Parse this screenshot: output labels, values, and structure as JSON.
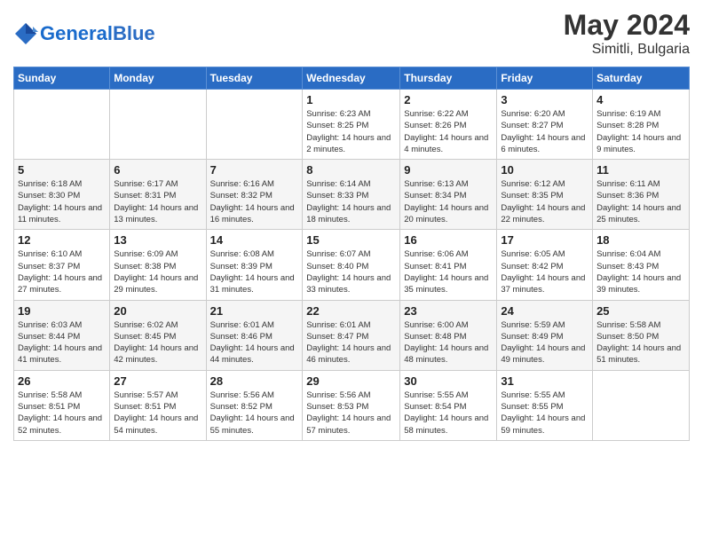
{
  "header": {
    "logo_general": "General",
    "logo_blue": "Blue",
    "month_year": "May 2024",
    "location": "Simitli, Bulgaria"
  },
  "weekdays": [
    "Sunday",
    "Monday",
    "Tuesday",
    "Wednesday",
    "Thursday",
    "Friday",
    "Saturday"
  ],
  "weeks": [
    [
      {
        "day": "",
        "sunrise": "",
        "sunset": "",
        "daylight": ""
      },
      {
        "day": "",
        "sunrise": "",
        "sunset": "",
        "daylight": ""
      },
      {
        "day": "",
        "sunrise": "",
        "sunset": "",
        "daylight": ""
      },
      {
        "day": "1",
        "sunrise": "Sunrise: 6:23 AM",
        "sunset": "Sunset: 8:25 PM",
        "daylight": "Daylight: 14 hours and 2 minutes."
      },
      {
        "day": "2",
        "sunrise": "Sunrise: 6:22 AM",
        "sunset": "Sunset: 8:26 PM",
        "daylight": "Daylight: 14 hours and 4 minutes."
      },
      {
        "day": "3",
        "sunrise": "Sunrise: 6:20 AM",
        "sunset": "Sunset: 8:27 PM",
        "daylight": "Daylight: 14 hours and 6 minutes."
      },
      {
        "day": "4",
        "sunrise": "Sunrise: 6:19 AM",
        "sunset": "Sunset: 8:28 PM",
        "daylight": "Daylight: 14 hours and 9 minutes."
      }
    ],
    [
      {
        "day": "5",
        "sunrise": "Sunrise: 6:18 AM",
        "sunset": "Sunset: 8:30 PM",
        "daylight": "Daylight: 14 hours and 11 minutes."
      },
      {
        "day": "6",
        "sunrise": "Sunrise: 6:17 AM",
        "sunset": "Sunset: 8:31 PM",
        "daylight": "Daylight: 14 hours and 13 minutes."
      },
      {
        "day": "7",
        "sunrise": "Sunrise: 6:16 AM",
        "sunset": "Sunset: 8:32 PM",
        "daylight": "Daylight: 14 hours and 16 minutes."
      },
      {
        "day": "8",
        "sunrise": "Sunrise: 6:14 AM",
        "sunset": "Sunset: 8:33 PM",
        "daylight": "Daylight: 14 hours and 18 minutes."
      },
      {
        "day": "9",
        "sunrise": "Sunrise: 6:13 AM",
        "sunset": "Sunset: 8:34 PM",
        "daylight": "Daylight: 14 hours and 20 minutes."
      },
      {
        "day": "10",
        "sunrise": "Sunrise: 6:12 AM",
        "sunset": "Sunset: 8:35 PM",
        "daylight": "Daylight: 14 hours and 22 minutes."
      },
      {
        "day": "11",
        "sunrise": "Sunrise: 6:11 AM",
        "sunset": "Sunset: 8:36 PM",
        "daylight": "Daylight: 14 hours and 25 minutes."
      }
    ],
    [
      {
        "day": "12",
        "sunrise": "Sunrise: 6:10 AM",
        "sunset": "Sunset: 8:37 PM",
        "daylight": "Daylight: 14 hours and 27 minutes."
      },
      {
        "day": "13",
        "sunrise": "Sunrise: 6:09 AM",
        "sunset": "Sunset: 8:38 PM",
        "daylight": "Daylight: 14 hours and 29 minutes."
      },
      {
        "day": "14",
        "sunrise": "Sunrise: 6:08 AM",
        "sunset": "Sunset: 8:39 PM",
        "daylight": "Daylight: 14 hours and 31 minutes."
      },
      {
        "day": "15",
        "sunrise": "Sunrise: 6:07 AM",
        "sunset": "Sunset: 8:40 PM",
        "daylight": "Daylight: 14 hours and 33 minutes."
      },
      {
        "day": "16",
        "sunrise": "Sunrise: 6:06 AM",
        "sunset": "Sunset: 8:41 PM",
        "daylight": "Daylight: 14 hours and 35 minutes."
      },
      {
        "day": "17",
        "sunrise": "Sunrise: 6:05 AM",
        "sunset": "Sunset: 8:42 PM",
        "daylight": "Daylight: 14 hours and 37 minutes."
      },
      {
        "day": "18",
        "sunrise": "Sunrise: 6:04 AM",
        "sunset": "Sunset: 8:43 PM",
        "daylight": "Daylight: 14 hours and 39 minutes."
      }
    ],
    [
      {
        "day": "19",
        "sunrise": "Sunrise: 6:03 AM",
        "sunset": "Sunset: 8:44 PM",
        "daylight": "Daylight: 14 hours and 41 minutes."
      },
      {
        "day": "20",
        "sunrise": "Sunrise: 6:02 AM",
        "sunset": "Sunset: 8:45 PM",
        "daylight": "Daylight: 14 hours and 42 minutes."
      },
      {
        "day": "21",
        "sunrise": "Sunrise: 6:01 AM",
        "sunset": "Sunset: 8:46 PM",
        "daylight": "Daylight: 14 hours and 44 minutes."
      },
      {
        "day": "22",
        "sunrise": "Sunrise: 6:01 AM",
        "sunset": "Sunset: 8:47 PM",
        "daylight": "Daylight: 14 hours and 46 minutes."
      },
      {
        "day": "23",
        "sunrise": "Sunrise: 6:00 AM",
        "sunset": "Sunset: 8:48 PM",
        "daylight": "Daylight: 14 hours and 48 minutes."
      },
      {
        "day": "24",
        "sunrise": "Sunrise: 5:59 AM",
        "sunset": "Sunset: 8:49 PM",
        "daylight": "Daylight: 14 hours and 49 minutes."
      },
      {
        "day": "25",
        "sunrise": "Sunrise: 5:58 AM",
        "sunset": "Sunset: 8:50 PM",
        "daylight": "Daylight: 14 hours and 51 minutes."
      }
    ],
    [
      {
        "day": "26",
        "sunrise": "Sunrise: 5:58 AM",
        "sunset": "Sunset: 8:51 PM",
        "daylight": "Daylight: 14 hours and 52 minutes."
      },
      {
        "day": "27",
        "sunrise": "Sunrise: 5:57 AM",
        "sunset": "Sunset: 8:51 PM",
        "daylight": "Daylight: 14 hours and 54 minutes."
      },
      {
        "day": "28",
        "sunrise": "Sunrise: 5:56 AM",
        "sunset": "Sunset: 8:52 PM",
        "daylight": "Daylight: 14 hours and 55 minutes."
      },
      {
        "day": "29",
        "sunrise": "Sunrise: 5:56 AM",
        "sunset": "Sunset: 8:53 PM",
        "daylight": "Daylight: 14 hours and 57 minutes."
      },
      {
        "day": "30",
        "sunrise": "Sunrise: 5:55 AM",
        "sunset": "Sunset: 8:54 PM",
        "daylight": "Daylight: 14 hours and 58 minutes."
      },
      {
        "day": "31",
        "sunrise": "Sunrise: 5:55 AM",
        "sunset": "Sunset: 8:55 PM",
        "daylight": "Daylight: 14 hours and 59 minutes."
      },
      {
        "day": "",
        "sunrise": "",
        "sunset": "",
        "daylight": ""
      }
    ]
  ]
}
